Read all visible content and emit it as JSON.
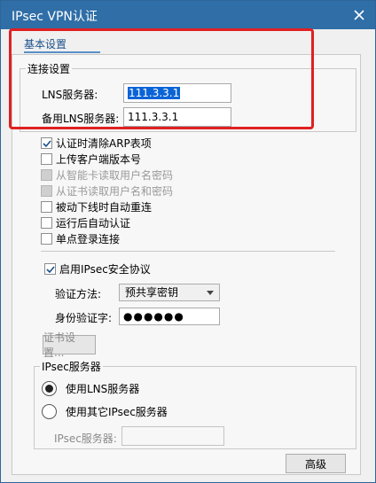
{
  "window": {
    "title": "IPsec VPN认证"
  },
  "tabs": [
    {
      "label": "基本设置"
    }
  ],
  "connection": {
    "group_title": "连接设置",
    "lns_server_label": "LNS服务器:",
    "lns_server_value": "111.3.3.1",
    "backup_lns_label": "备用LNS服务器:",
    "backup_lns_value": "111.3.3.1"
  },
  "options": [
    {
      "label": "认证时清除ARP表项",
      "checked": true,
      "disabled": false
    },
    {
      "label": "上传客户端版本号",
      "checked": false,
      "disabled": false
    },
    {
      "label": "从智能卡读取用户名密码",
      "checked": false,
      "disabled": true
    },
    {
      "label": "从证书读取用户名和密码",
      "checked": false,
      "disabled": true
    },
    {
      "label": "被动下线时自动重连",
      "checked": false,
      "disabled": false
    },
    {
      "label": "运行后自动认证",
      "checked": false,
      "disabled": false
    },
    {
      "label": "单点登录连接",
      "checked": false,
      "disabled": false
    }
  ],
  "ipsec": {
    "enable_label": "启用IPsec安全协议",
    "enable_checked": true,
    "auth_method_label": "验证方法:",
    "auth_method_value": "预共享密钥",
    "auth_key_label": "身份验证字:",
    "auth_key_value": "●●●●●●",
    "cert_button_label": "证书设置..."
  },
  "ipsec_server": {
    "group_title": "IPsec服务器",
    "use_lns_label": "使用LNS服务器",
    "use_other_label": "使用其它IPsec服务器",
    "server_label": "IPsec服务器:",
    "server_value": ""
  },
  "buttons": {
    "advanced_label": "高级"
  }
}
